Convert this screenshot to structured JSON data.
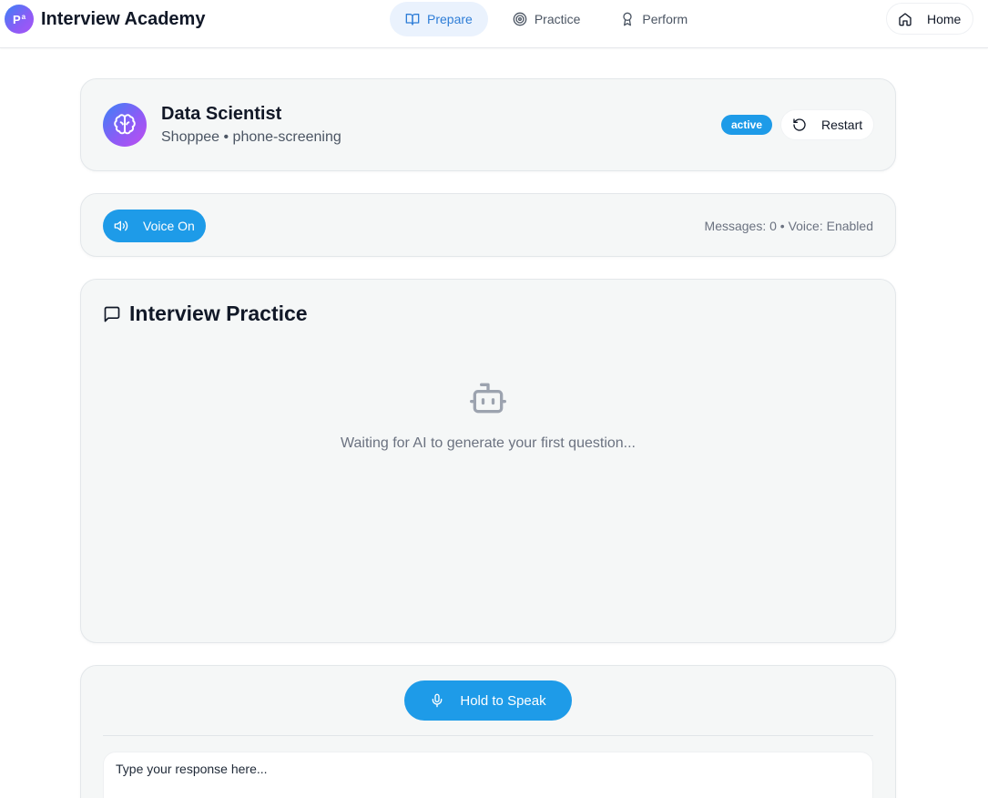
{
  "brand": {
    "logo_text": "P",
    "logo_sup": "a",
    "name": "Interview Academy"
  },
  "nav": {
    "items": [
      {
        "label": "Prepare",
        "icon": "book-open-icon",
        "active": true
      },
      {
        "label": "Practice",
        "icon": "target-icon",
        "active": false
      },
      {
        "label": "Perform",
        "icon": "award-icon",
        "active": false
      }
    ],
    "home_label": "Home"
  },
  "session": {
    "role": "Data Scientist",
    "subtitle": "Shoppee • phone-screening",
    "status": "active",
    "restart_label": "Restart"
  },
  "voice": {
    "button_label": "Voice On",
    "status_text": "Messages: 0 • Voice: Enabled"
  },
  "practice": {
    "title": "Interview Practice",
    "empty_text": "Waiting for AI to generate your first question..."
  },
  "input": {
    "speak_label": "Hold to Speak",
    "placeholder": "Type your response here...",
    "value": ""
  },
  "colors": {
    "accent": "#1e9be8",
    "active_nav_bg": "#eaf2fd",
    "active_nav_text": "#2e7dd7",
    "card_bg": "#f5f7f7"
  }
}
